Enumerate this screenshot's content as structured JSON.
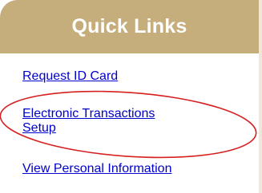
{
  "quick_links": {
    "title": "Quick Links",
    "items": [
      {
        "label": "Request ID Card"
      },
      {
        "label": "Electronic Transactions",
        "label_line2": "Setup"
      },
      {
        "label": "View Personal Information"
      }
    ]
  },
  "colors": {
    "header_bg": "#c5ad7c",
    "link": "#0000cc",
    "annotation": "#d62020"
  },
  "annotation": {
    "shape": "ellipse",
    "highlighted_item": "Electronic Transactions Setup"
  }
}
